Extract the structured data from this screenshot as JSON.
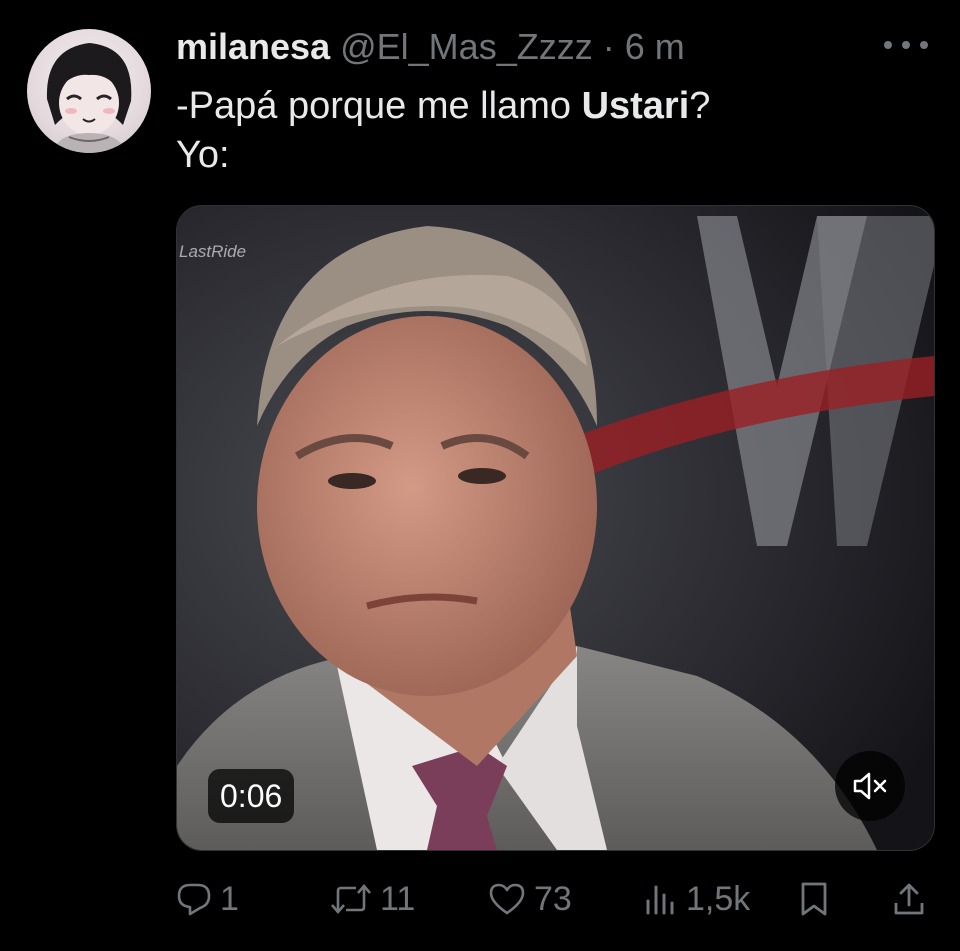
{
  "post": {
    "display_name": "milanesa",
    "handle": "@El_Mas_Zzzz",
    "separator": "·",
    "time": "6 m",
    "text_line1_before": "-Papá porque me llamo ",
    "text_line1_bold": "Ustari",
    "text_line1_after": "?",
    "text_line2": "Yo:"
  },
  "media": {
    "watermark": "LastRide",
    "duration": "0:06",
    "muted": true
  },
  "actions": {
    "replies": "1",
    "reposts": "11",
    "likes": "73",
    "views": "1,5k"
  },
  "icons": {
    "more": "more-dots-icon",
    "reply": "reply-icon",
    "repost": "repost-icon",
    "like": "heart-icon",
    "views": "views-chart-icon",
    "bookmark": "bookmark-icon",
    "share": "share-icon",
    "mute": "speaker-muted-icon"
  },
  "colors": {
    "background": "#000000",
    "text": "#e7e9ea",
    "muted": "#71767b"
  }
}
